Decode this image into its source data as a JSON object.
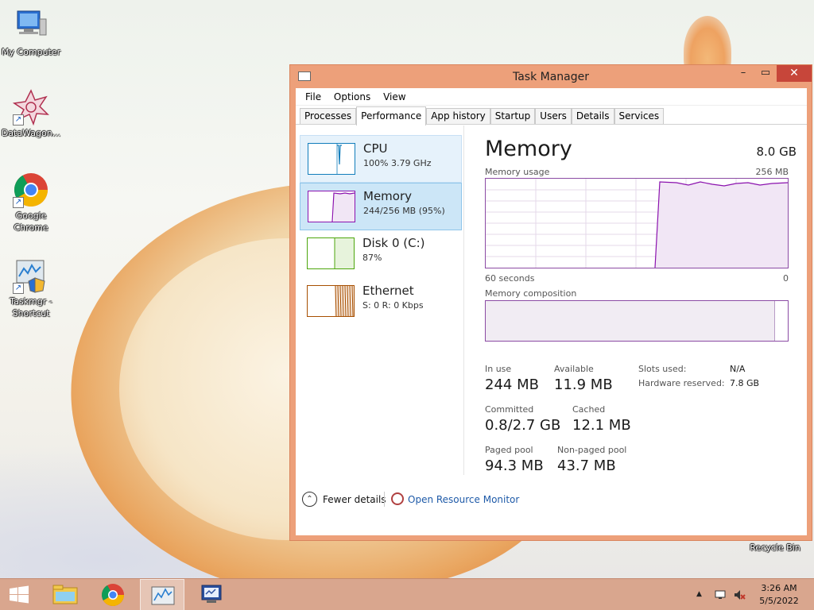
{
  "desktop": {
    "icons": [
      {
        "label": "My Computer"
      },
      {
        "label": "DataWagon..."
      },
      {
        "label": "Google Chrome"
      },
      {
        "label": "Taskmgr - Shortcut"
      }
    ],
    "recycle_bin": "Recycle Bin"
  },
  "window": {
    "title": "Task Manager",
    "min": "–",
    "max": "▭",
    "close": "✕"
  },
  "menu": [
    "File",
    "Options",
    "View"
  ],
  "tabs": [
    "Processes",
    "Performance",
    "App history",
    "Startup",
    "Users",
    "Details",
    "Services"
  ],
  "active_tab": "Performance",
  "resources": [
    {
      "name": "CPU",
      "sub": "100%  3.79 GHz",
      "color": "#117dbb"
    },
    {
      "name": "Memory",
      "sub": "244/256 MB (95%)",
      "color": "#8b12ae"
    },
    {
      "name": "Disk 0 (C:)",
      "sub": "87%",
      "color": "#4da60c"
    },
    {
      "name": "Ethernet",
      "sub": "S: 0  R: 0 Kbps",
      "color": "#a74f01"
    }
  ],
  "memory": {
    "title": "Memory",
    "total": "8.0 GB",
    "usage_label": "Memory usage",
    "usage_max": "256 MB",
    "time_left": "60 seconds",
    "time_right": "0",
    "composition_label": "Memory composition",
    "stats": {
      "in_use_label": "In use",
      "in_use": "244 MB",
      "available_label": "Available",
      "available": "11.9 MB",
      "committed_label": "Committed",
      "committed": "0.8/2.7 GB",
      "cached_label": "Cached",
      "cached": "12.1 MB",
      "paged_label": "Paged pool",
      "paged": "94.3 MB",
      "nonpaged_label": "Non-paged pool",
      "nonpaged": "43.7 MB",
      "slots_label": "Slots used:",
      "slots": "N/A",
      "hw_label": "Hardware reserved:",
      "hw": "7.8 GB"
    },
    "accent": "#8b12ae"
  },
  "footer": {
    "fewer_details": "Fewer details",
    "open_resource_monitor": "Open Resource Monitor"
  },
  "taskbar": {
    "time": "3:26 AM",
    "date": "5/5/2022"
  }
}
